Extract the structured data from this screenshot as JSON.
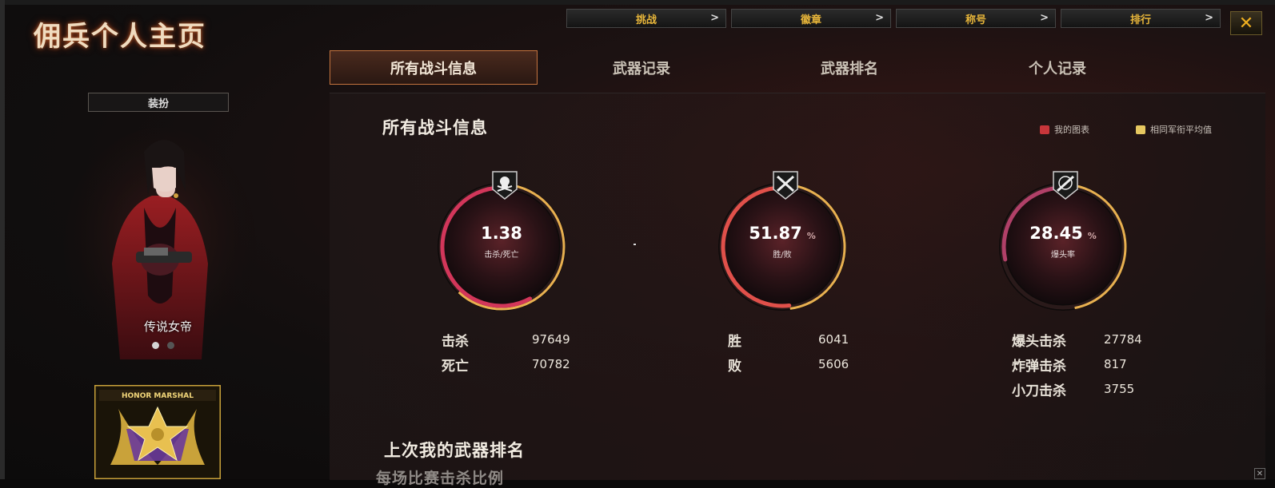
{
  "window": {
    "title": "佣兵个人主页",
    "close_label": "✕"
  },
  "top_nav": [
    {
      "label": "挑战"
    },
    {
      "label": "徽章"
    },
    {
      "label": "称号"
    },
    {
      "label": "排行"
    }
  ],
  "tabs": [
    {
      "label": "所有战斗信息",
      "active": true
    },
    {
      "label": "武器记录",
      "active": false
    },
    {
      "label": "武器排名",
      "active": false
    },
    {
      "label": "个人记录",
      "active": false
    }
  ],
  "left": {
    "dress_button": "装扮",
    "character_name": "传说女帝",
    "carousel_page": 1,
    "carousel_total": 2,
    "badge_text": "HONOR MARSHAL"
  },
  "section": {
    "title": "所有战斗信息",
    "legend": [
      {
        "label": "我的图表",
        "color": "#c8363a"
      },
      {
        "label": "相同军衔平均值",
        "color": "#e6c860"
      }
    ]
  },
  "rings": [
    {
      "icon": "skull-crossbones-icon",
      "value": "1.38",
      "unit": "",
      "label": "击杀/死亡",
      "fill_fraction": 0.58,
      "accent": "#d2365a",
      "avg_fraction": 0.62
    },
    {
      "icon": "crossed-rifles-icon",
      "value": "51.87",
      "unit": "%",
      "label": "胜/败",
      "fill_fraction": 0.5187,
      "accent": "#e0504a",
      "avg_fraction": 0.48
    },
    {
      "icon": "crosshair-rifle-icon",
      "value": "28.45",
      "unit": "%",
      "label": "爆头率",
      "fill_fraction": 0.2845,
      "accent": "#b04068",
      "avg_fraction": 0.47
    }
  ],
  "stats": {
    "kd": [
      {
        "label": "击杀",
        "value": "97649"
      },
      {
        "label": "死亡",
        "value": "70782"
      }
    ],
    "wl": [
      {
        "label": "胜",
        "value": "6041"
      },
      {
        "label": "败",
        "value": "5606"
      }
    ],
    "hs": [
      {
        "label": "爆头击杀",
        "value": "27784"
      },
      {
        "label": "炸弹击杀",
        "value": "817"
      },
      {
        "label": "小刀击杀",
        "value": "3755"
      }
    ]
  },
  "subsection": {
    "title": "上次我的武器排名",
    "subtitle": "每场比赛击杀比例"
  }
}
